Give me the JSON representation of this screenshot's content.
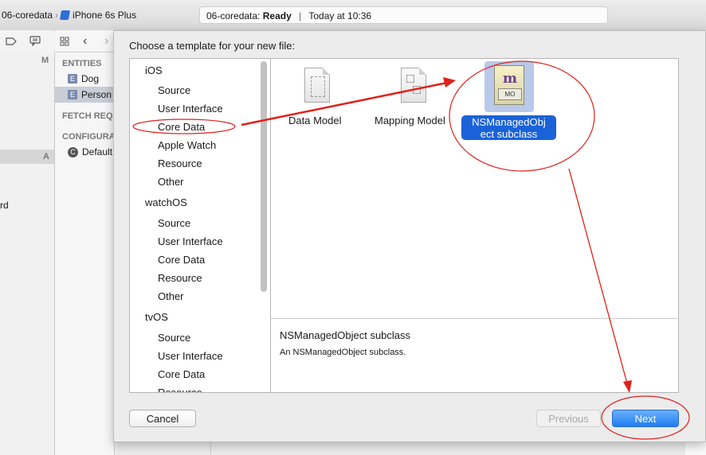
{
  "toolbar": {
    "project": "06-coredata",
    "device": "iPhone 6s Plus",
    "status_project": "06-coredata:",
    "status_state": "Ready",
    "status_time": "Today at 10:36"
  },
  "navigator": {
    "col_m": "M",
    "col_a": "A",
    "partial_text": "rd"
  },
  "editor": {
    "entities_header": "ENTITIES",
    "entities": [
      {
        "icon": "E",
        "name": "Dog"
      },
      {
        "icon": "E",
        "name": "Person"
      }
    ],
    "fetch_header": "FETCH REQ",
    "config_header": "CONFIGURA",
    "config_icon": "C",
    "config_item": "Default"
  },
  "dialog": {
    "title": "Choose a template for your new file:",
    "categories": [
      {
        "label": "iOS",
        "level": 0
      },
      {
        "label": "Source",
        "level": 1
      },
      {
        "label": "User Interface",
        "level": 1
      },
      {
        "label": "Core Data",
        "level": 1
      },
      {
        "label": "Apple Watch",
        "level": 1
      },
      {
        "label": "Resource",
        "level": 1
      },
      {
        "label": "Other",
        "level": 1
      },
      {
        "label": "watchOS",
        "level": 0
      },
      {
        "label": "Source",
        "level": 1
      },
      {
        "label": "User Interface",
        "level": 1
      },
      {
        "label": "Core Data",
        "level": 1
      },
      {
        "label": "Resource",
        "level": 1
      },
      {
        "label": "Other",
        "level": 1
      },
      {
        "label": "tvOS",
        "level": 0
      },
      {
        "label": "Source",
        "level": 1
      },
      {
        "label": "User Interface",
        "level": 1
      },
      {
        "label": "Core Data",
        "level": 1
      },
      {
        "label": "Resource",
        "level": 1
      }
    ],
    "templates": [
      {
        "label": "Data Model",
        "icon": "data-model-icon"
      },
      {
        "label": "Mapping Model",
        "icon": "mapping-model-icon"
      },
      {
        "label_line1": "NSManagedObj",
        "label_line2": "ect subclass",
        "icon": "nsmanagedobject-icon",
        "icon_letter": "m",
        "icon_badge": "MO",
        "selected": true
      }
    ],
    "description_title": "NSManagedObject subclass",
    "description_text": "An NSManagedObject subclass.",
    "cancel_label": "Cancel",
    "previous_label": "Previous",
    "next_label": "Next"
  },
  "annotations": {
    "color": "#e0201b"
  }
}
